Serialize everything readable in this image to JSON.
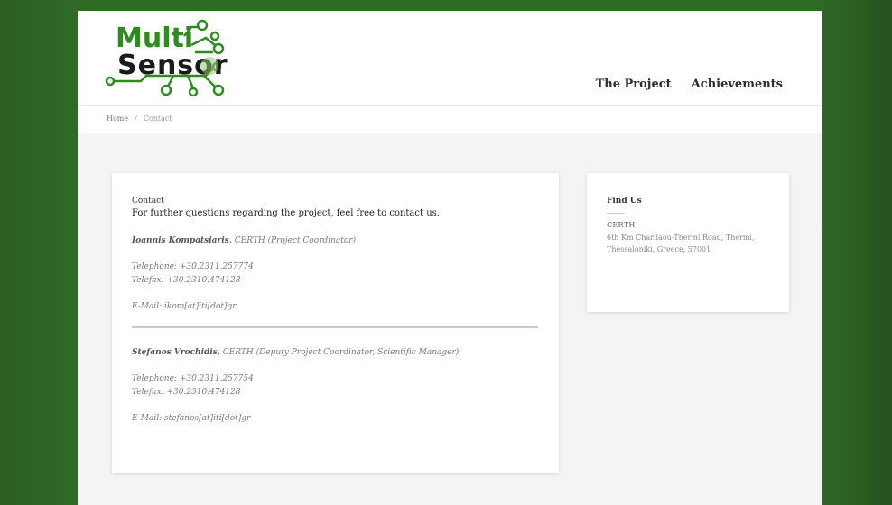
{
  "brand": {
    "line1": "Multi",
    "line2": "Sensor",
    "accent": "#2e8b1e",
    "dark": "#1a1a1a"
  },
  "nav": {
    "items": [
      "The Project",
      "Achievements"
    ]
  },
  "breadcrumb": {
    "home": "Home",
    "separator": "/",
    "current": "Contact"
  },
  "contact": {
    "title": "Contact",
    "lead": "For further questions regarding the project, feel free to contact us.",
    "people": [
      {
        "name": "Ioannis Kompatsiaris,",
        "role": "CERTH (Project Coordinator)",
        "telephone": "Telephone: +30.2311.257774",
        "telefax": "Telefax: +30.2310.474128",
        "email": "E-Mail: ikom[at]iti[dot]gr"
      },
      {
        "name": "Stefanos Vrochidis,",
        "role": "CERTH (Deputy Project Coordinator, Scientific Manager)",
        "telephone": "Telephone: +30.2311.257754",
        "telefax": "Telefax: +30.2310.474128",
        "email": "E-Mail: stefanos[at]iti[dot]gr"
      }
    ]
  },
  "find_us": {
    "title": "Find Us",
    "org": "CERTH",
    "address_line1": "6th Km Charilaou-Thermi Road, Thermi,",
    "address_line2": "Thessaloniki, Greece, 57001"
  }
}
